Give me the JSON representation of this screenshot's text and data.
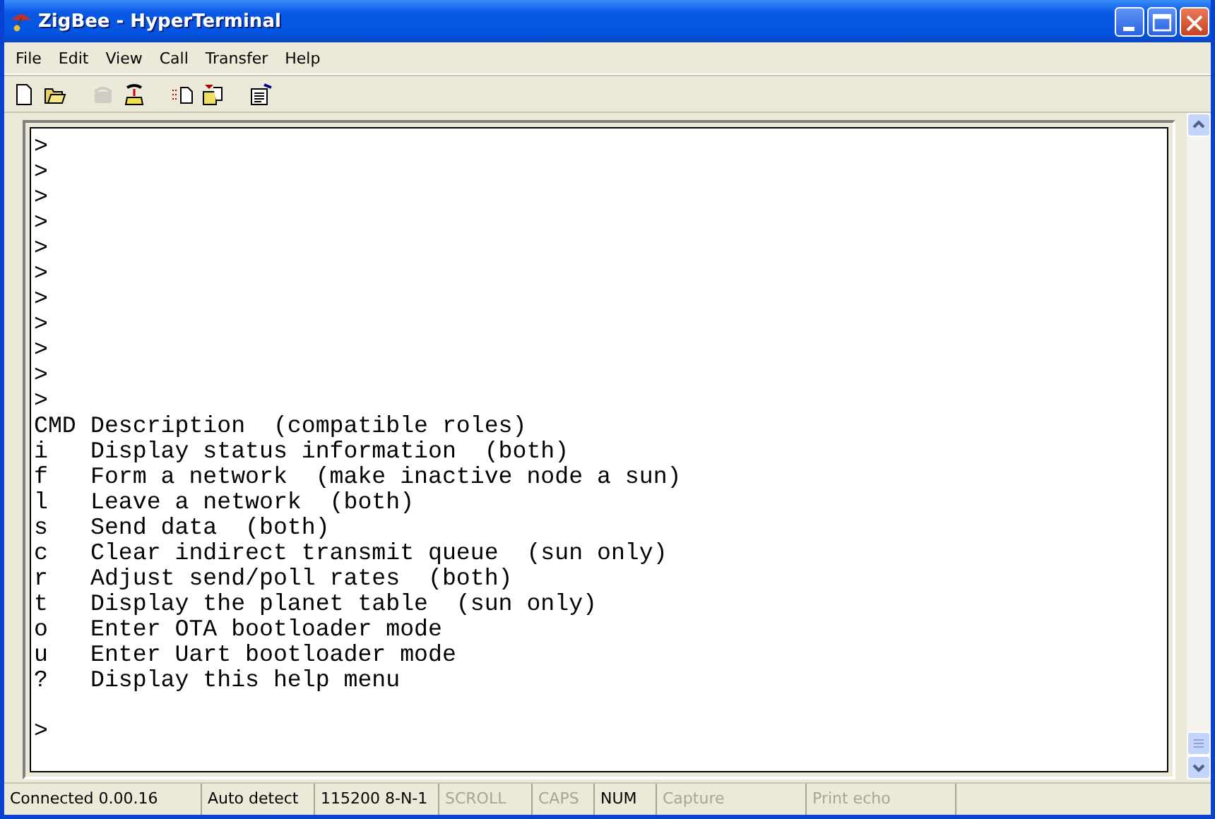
{
  "window": {
    "title": "ZigBee - HyperTerminal"
  },
  "menu": [
    "File",
    "Edit",
    "View",
    "Call",
    "Transfer",
    "Help"
  ],
  "toolbar": [
    {
      "kind": "new",
      "disabled": false
    },
    {
      "kind": "open",
      "disabled": false
    },
    {
      "kind": "call",
      "disabled": true
    },
    {
      "kind": "hangup",
      "disabled": false
    },
    {
      "kind": "send",
      "disabled": false
    },
    {
      "kind": "receive",
      "disabled": false
    },
    {
      "kind": "properties",
      "disabled": false
    }
  ],
  "terminal": {
    "prompts": [
      ">",
      ">",
      ">",
      ">",
      ">",
      ">",
      ">",
      ">",
      ">",
      ">",
      ">"
    ],
    "header": {
      "cmd": "CMD",
      "description": "Description  (compatible roles)"
    },
    "commands": [
      {
        "cmd": "i",
        "description": "Display status information  (both)"
      },
      {
        "cmd": "f",
        "description": "Form a network  (make inactive node a sun)"
      },
      {
        "cmd": "l",
        "description": "Leave a network  (both)"
      },
      {
        "cmd": "s",
        "description": "Send data  (both)"
      },
      {
        "cmd": "c",
        "description": "Clear indirect transmit queue  (sun only)"
      },
      {
        "cmd": "r",
        "description": "Adjust send/poll rates  (both)"
      },
      {
        "cmd": "t",
        "description": "Display the planet table  (sun only)"
      },
      {
        "cmd": "o",
        "description": "Enter OTA bootloader mode"
      },
      {
        "cmd": "u",
        "description": "Enter Uart bootloader mode"
      },
      {
        "cmd": "?",
        "description": "Display this help menu"
      }
    ],
    "final_prompt": ">"
  },
  "status_bar": [
    {
      "text": "Connected 0.00.16",
      "disabled": false
    },
    {
      "text": "Auto detect",
      "disabled": false
    },
    {
      "text": "115200 8-N-1",
      "disabled": false
    },
    {
      "text": "SCROLL",
      "disabled": true
    },
    {
      "text": "CAPS",
      "disabled": true
    },
    {
      "text": "NUM",
      "disabled": false
    },
    {
      "text": "Capture",
      "disabled": true
    },
    {
      "text": "Print echo",
      "disabled": true
    }
  ]
}
